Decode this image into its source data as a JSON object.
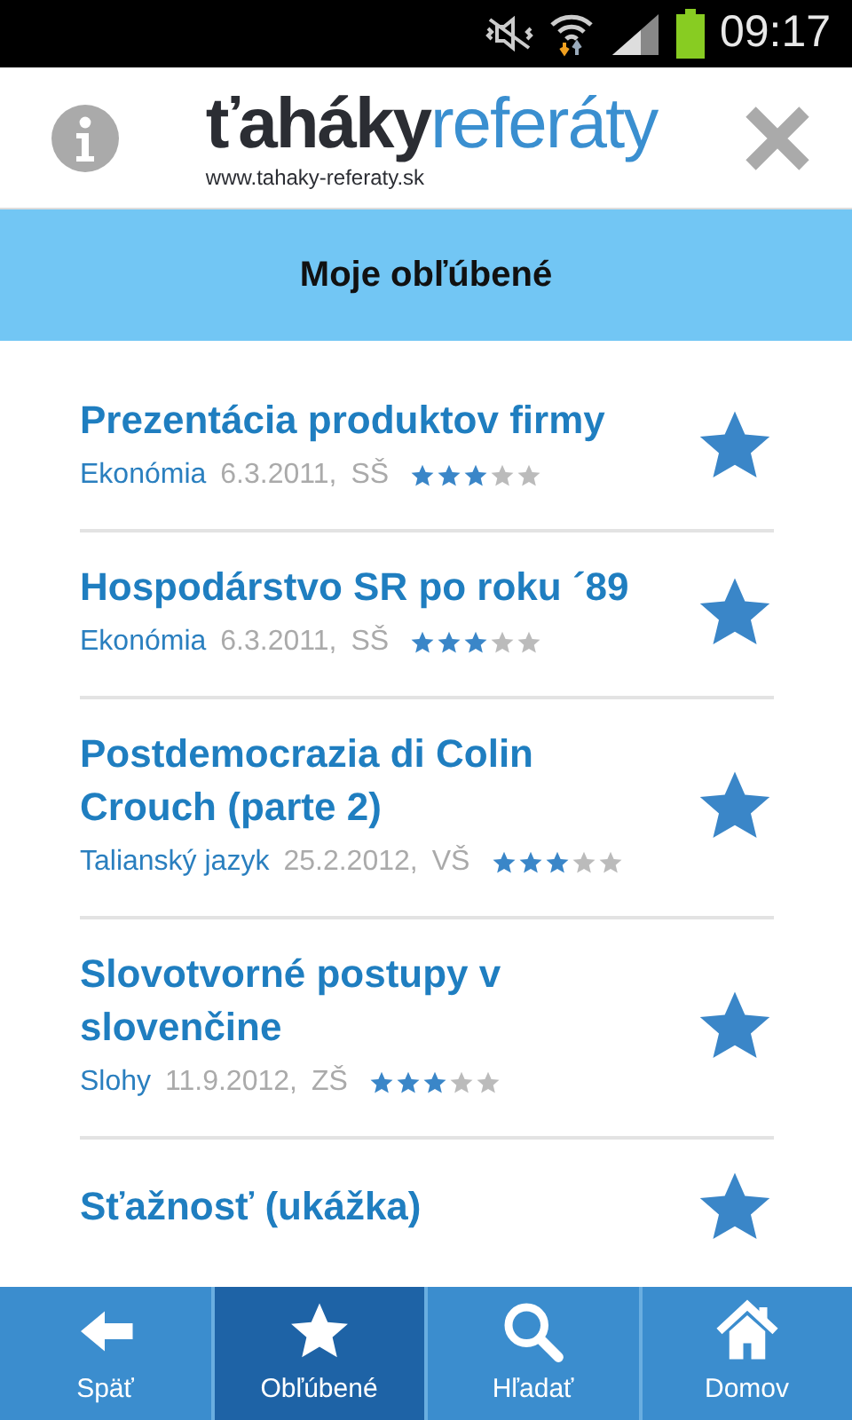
{
  "status_bar": {
    "time": "09:17"
  },
  "header": {
    "logo_dark": "ťaháky",
    "logo_blue": "referáty",
    "url": "www.tahaky-referaty.sk"
  },
  "title": "Moje obľúbené",
  "items": [
    {
      "title": "Prezentácia produktov firmy",
      "subject": "Ekonómia",
      "date": "6.3.2011,",
      "level": "SŠ",
      "stars": 3,
      "favorite": true
    },
    {
      "title": "Hospodárstvo SR po roku ´89",
      "subject": "Ekonómia",
      "date": "6.3.2011,",
      "level": "SŠ",
      "stars": 3,
      "favorite": true
    },
    {
      "title": "Postdemocrazia di Colin Crouch (parte 2)",
      "subject": "Talianský jazyk",
      "date": "25.2.2012,",
      "level": "VŠ",
      "stars": 3,
      "favorite": true
    },
    {
      "title": "Slovotvorné postupy v slovenčine",
      "subject": "Slohy",
      "date": "11.9.2012,",
      "level": "ZŠ",
      "stars": 3,
      "favorite": true
    },
    {
      "title": "Sťažnosť (ukážka)",
      "favorite": true
    }
  ],
  "nav": [
    {
      "label": "Späť",
      "kind": "back",
      "selected": false
    },
    {
      "label": "Obľúbené",
      "kind": "favorites",
      "selected": true
    },
    {
      "label": "Hľadať",
      "kind": "search",
      "selected": false
    },
    {
      "label": "Domov",
      "kind": "home",
      "selected": false
    }
  ]
}
